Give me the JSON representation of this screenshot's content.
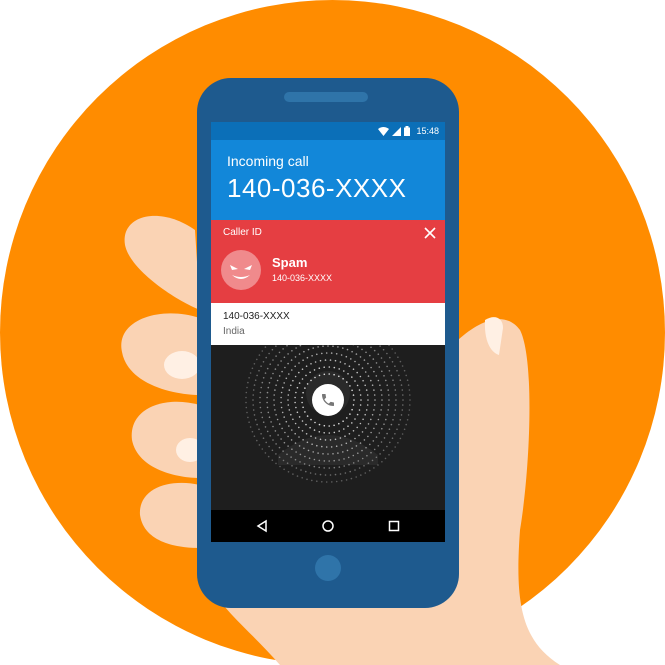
{
  "colors": {
    "background_circle": "#FF8C00",
    "phone_body": "#1E5A8E",
    "header_blue": "#1287D9",
    "spam_red": "#E53E42",
    "skin": "#FAD3B4"
  },
  "statusbar": {
    "time": "15:48",
    "icons": [
      "wifi-icon",
      "signal-icon",
      "battery-icon"
    ]
  },
  "call": {
    "label": "Incoming call",
    "number": "140-036-XXXX"
  },
  "caller_id": {
    "label": "Caller ID",
    "title": "Spam",
    "number": "140-036-XXXX"
  },
  "info": {
    "number": "140-036-XXXX",
    "country": "India"
  },
  "navbar": {
    "icons": [
      "back-icon",
      "home-icon",
      "recents-icon"
    ]
  }
}
